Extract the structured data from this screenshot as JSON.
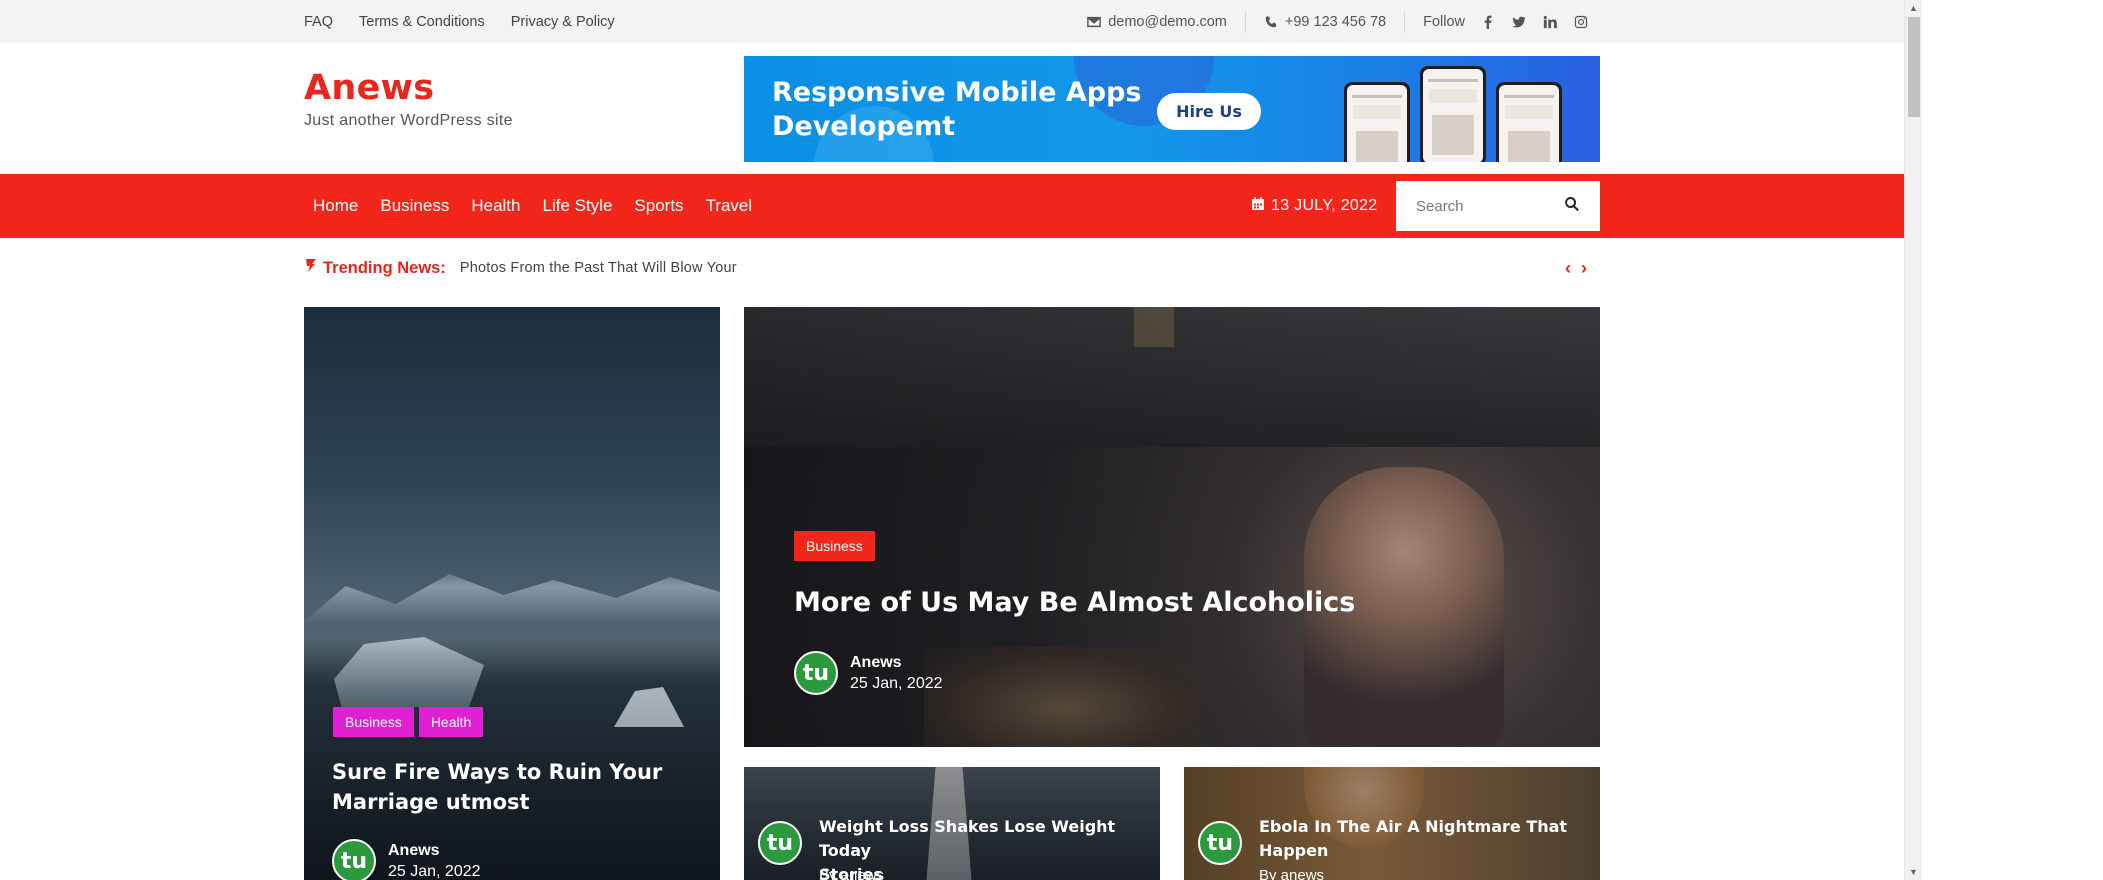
{
  "topbar": {
    "links": [
      "FAQ",
      "Terms & Conditions",
      "Privacy & Policy"
    ],
    "email": "demo@demo.com",
    "phone": "+99 123 456 78",
    "follow_label": "Follow",
    "social_icons": [
      "facebook-icon",
      "twitter-icon",
      "linkedin-icon",
      "instagram-icon"
    ]
  },
  "brand": {
    "title": "Anews",
    "tagline": "Just another WordPress site"
  },
  "banner": {
    "line1": "Responsive Mobile Apps",
    "line2": "Developemt",
    "button": "Hire Us"
  },
  "nav": {
    "items": [
      "Home",
      "Business",
      "Health",
      "Life Style",
      "Sports",
      "Travel"
    ],
    "date": "13 JULY, 2022",
    "search_placeholder": "Search"
  },
  "trending": {
    "label": "Trending News:",
    "text": "Photos From the Past That Will Blow Your"
  },
  "cards": [
    {
      "tags": [
        "Business",
        "Health"
      ],
      "title_line1": "Sure Fire Ways to Ruin Your",
      "title_line2": "Marriage utmost",
      "author": "Anews",
      "date": "25 Jan, 2022",
      "avatar_text": "tu"
    },
    {
      "tags": [
        "Business"
      ],
      "title": "More of Us May Be Almost Alcoholics",
      "author": "Anews",
      "date": "25 Jan, 2022",
      "avatar_text": "tu"
    },
    {
      "title_line1": "Weight Loss Shakes Lose Weight Today",
      "title_line2": "Stories",
      "byline": "By anews",
      "avatar_text": "tu"
    },
    {
      "title_line1": "Ebola In The Air A Nightmare That",
      "title_line2": "Happen",
      "byline": "By anews",
      "avatar_text": "tu"
    }
  ],
  "colors": {
    "accent": "#f2261a",
    "tag_business_health": "#e11fd3",
    "tag_business_red": "#f2261a",
    "avatar_green": "#2a9a3c"
  }
}
